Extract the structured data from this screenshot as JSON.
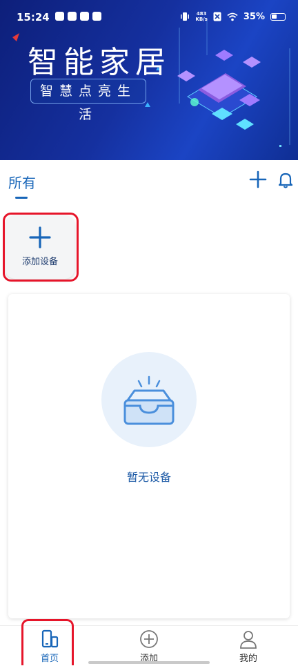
{
  "status_bar": {
    "time": "15:24",
    "net_speed_value": "483",
    "net_speed_unit": "KB/s",
    "battery": "35%"
  },
  "banner": {
    "title": "智能家居",
    "subtitle": "智慧点亮生活"
  },
  "header": {
    "tab_label": "所有"
  },
  "add_device": {
    "label": "添加设备"
  },
  "empty_state": {
    "label": "暂无设备"
  },
  "bottom_nav": {
    "items": [
      {
        "label": "首页",
        "icon": "phone-tablet-icon",
        "active": true
      },
      {
        "label": "添加",
        "icon": "add-circle-icon",
        "active": false
      },
      {
        "label": "我的",
        "icon": "user-icon",
        "active": false
      }
    ]
  },
  "colors": {
    "accent": "#1765b8",
    "highlight_frame": "#e6152a",
    "banner_bg": "#15309f"
  }
}
